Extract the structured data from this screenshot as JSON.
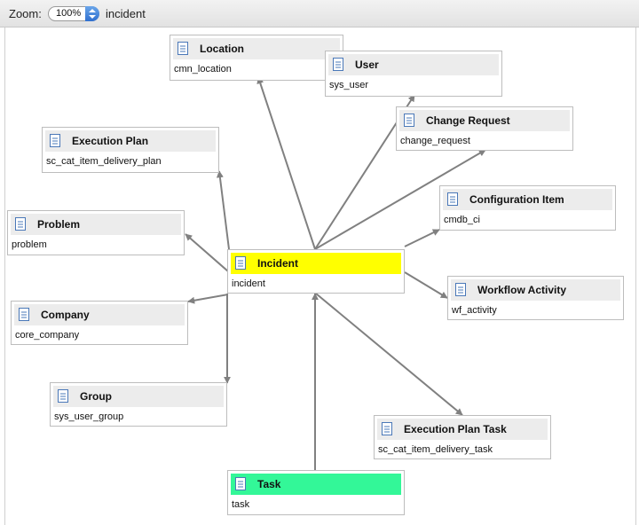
{
  "toolbar": {
    "zoom_label": "Zoom:",
    "zoom_value": "100%",
    "table_name": "incident"
  },
  "colors": {
    "current_header": "#ffff00",
    "parent_header": "#33f798",
    "header": "#ececec",
    "edge": "#808080"
  },
  "nodes": {
    "location": {
      "label": "Location",
      "table": "cmn_location"
    },
    "user": {
      "label": "User",
      "table": "sys_user"
    },
    "change_request": {
      "label": "Change Request",
      "table": "change_request"
    },
    "execution_plan": {
      "label": "Execution Plan",
      "table": "sc_cat_item_delivery_plan"
    },
    "configuration_item": {
      "label": "Configuration Item",
      "table": "cmdb_ci"
    },
    "problem": {
      "label": "Problem",
      "table": "problem"
    },
    "incident": {
      "label": "Incident",
      "table": "incident"
    },
    "workflow_activity": {
      "label": "Workflow Activity",
      "table": "wf_activity"
    },
    "company": {
      "label": "Company",
      "table": "core_company"
    },
    "group": {
      "label": "Group",
      "table": "sys_user_group"
    },
    "execution_plan_task": {
      "label": "Execution Plan Task",
      "table": "sc_cat_item_delivery_task"
    },
    "task": {
      "label": "Task",
      "table": "task"
    }
  }
}
